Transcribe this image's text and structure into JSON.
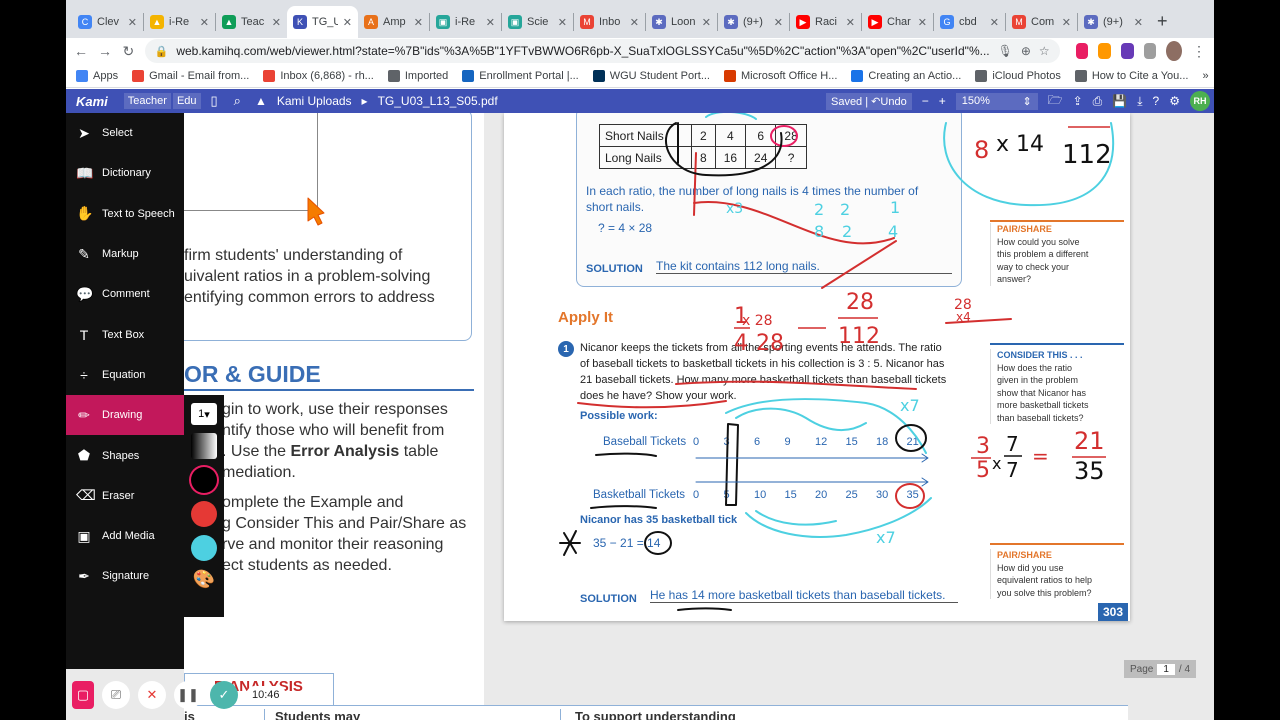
{
  "browser": {
    "tabs": [
      {
        "label": "Clev",
        "color": "#4285f4",
        "glyph": "C"
      },
      {
        "label": "i-Re",
        "color": "#f4b400",
        "glyph": "▲"
      },
      {
        "label": "Teac",
        "color": "#0f9d58",
        "glyph": "▲"
      },
      {
        "label": "TG_U",
        "color": "#3f51b5",
        "glyph": "K",
        "active": true
      },
      {
        "label": "Amp",
        "color": "#e8711a",
        "glyph": "A"
      },
      {
        "label": "i-Re",
        "color": "#26a69a",
        "glyph": "▣"
      },
      {
        "label": "Scie",
        "color": "#26a69a",
        "glyph": "▣"
      },
      {
        "label": "Inbo",
        "color": "#ea4335",
        "glyph": "M"
      },
      {
        "label": "Loon",
        "color": "#5c6bc0",
        "glyph": "✱"
      },
      {
        "label": "(9+)",
        "color": "#5c6bc0",
        "glyph": "✱"
      },
      {
        "label": "Raci",
        "color": "#ff0000",
        "glyph": "▶"
      },
      {
        "label": "Char",
        "color": "#ff0000",
        "glyph": "▶"
      },
      {
        "label": "cbd",
        "color": "#4285f4",
        "glyph": "G"
      },
      {
        "label": "Com",
        "color": "#ea4335",
        "glyph": "M"
      },
      {
        "label": "(9+)",
        "color": "#5c6bc0",
        "glyph": "✱"
      }
    ],
    "new_tab": "+",
    "url": "web.kamihq.com/web/viewer.html?state=%7B\"ids\"%3A%5B\"1YFTvBWWO6R6pb-X_SuaTxlOGLSSYCa5u\"%5D%2C\"action\"%3A\"open\"%2C\"userId\"%...",
    "bookmarks": [
      {
        "label": "Apps",
        "color": "#4285f4"
      },
      {
        "label": "Gmail - Email from...",
        "color": "#ea4335"
      },
      {
        "label": "Inbox (6,868) - rh...",
        "color": "#ea4335"
      },
      {
        "label": "Imported",
        "color": "#5f6368"
      },
      {
        "label": "Enrollment Portal |...",
        "color": "#1565c0"
      },
      {
        "label": "WGU Student Port...",
        "color": "#003057"
      },
      {
        "label": "Microsoft Office H...",
        "color": "#d83b01"
      },
      {
        "label": "Creating an Actio...",
        "color": "#1a73e8"
      },
      {
        "label": "iCloud Photos",
        "color": "#5f6368"
      },
      {
        "label": "How to Cite a You...",
        "color": "#5f6368"
      }
    ],
    "bookmarks_more": "»"
  },
  "kami": {
    "logo": "Kami",
    "role_teacher": "Teacher",
    "role_edu": "Edu",
    "breadcrumb_folder": "Kami Uploads",
    "breadcrumb_sep": "▸",
    "file_name": "TG_U03_L13_S05.pdf",
    "saved": "Saved",
    "undo": "Undo",
    "zoom_minus": "−",
    "zoom_plus": "+",
    "zoom": "150%",
    "avatar": "RH"
  },
  "tools": [
    {
      "label": "Select",
      "icon": "➤"
    },
    {
      "label": "Dictionary",
      "icon": "📖"
    },
    {
      "label": "Text to Speech",
      "icon": "✋"
    },
    {
      "label": "Markup",
      "icon": "✎"
    },
    {
      "label": "Comment",
      "icon": "💬"
    },
    {
      "label": "Text Box",
      "icon": "T"
    },
    {
      "label": "Equation",
      "icon": "÷"
    },
    {
      "label": "Drawing",
      "icon": "✏",
      "active": true
    },
    {
      "label": "Shapes",
      "icon": "⬟"
    },
    {
      "label": "Eraser",
      "icon": "⌫"
    },
    {
      "label": "Add Media",
      "icon": "▣"
    },
    {
      "label": "Signature",
      "icon": "✒"
    }
  ],
  "drawing_panel": {
    "line_width": "1",
    "colors": [
      "#000000",
      "#e53935",
      "#4dd0e1"
    ]
  },
  "recording": {
    "time": "10:46"
  },
  "left_page": {
    "lines_top": [
      "firm students' understanding of",
      "uivalent ratios in a problem-solving",
      "entifying common errors to address"
    ],
    "heading": "OR & GUIDE",
    "lines_mid": [
      "gin to work, use their responses",
      "ntify those who will benefit from",
      ". Use the ",
      "mediation.",
      "omplete the Example and",
      "g Consider This and Pair/Share as",
      "rve and monitor their reasoning",
      "ect students as needed."
    ],
    "error_analysis_bold": "Error Analysis",
    "error_analysis_after": " table",
    "bottom_heading": "R ANALYSIS"
  },
  "right_page": {
    "table": {
      "rows": [
        {
          "label": "Short Nails",
          "values": [
            "2",
            "4",
            "6",
            "28"
          ]
        },
        {
          "label": "Long Nails",
          "values": [
            "8",
            "16",
            "24",
            "?"
          ]
        }
      ]
    },
    "ratio_text_1": "In each ratio, the number of long nails is 4 times the number of",
    "ratio_text_2": "short nails.",
    "equation_1": "? = 4 × 28",
    "solution_label": "SOLUTION",
    "solution_1": "The kit contains 112 long nails.",
    "pair_share_1": {
      "title": "PAIR/SHARE",
      "lines": [
        "How could you solve",
        "this problem a different",
        "way to check your",
        "answer?"
      ]
    },
    "apply_it": "Apply It",
    "problem_number": "1",
    "problem_lines": [
      "Nicanor keeps the tickets from all the sporting events he attends. The ratio",
      "of baseball tickets to basketball tickets in his collection is 3 : 5. Nicanor has",
      "21 baseball tickets. How many more basketball tickets than baseball tickets",
      "does he have? Show your work."
    ],
    "consider_this": {
      "title": "CONSIDER THIS . . .",
      "lines": [
        "How does the ratio",
        "given in the problem",
        "show that Nicanor has",
        "more basketball tickets",
        "than baseball tickets?"
      ]
    },
    "possible_work": "Possible work:",
    "baseball_label": "Baseball Tickets",
    "baseball_ticks": [
      "0",
      "3",
      "6",
      "9",
      "12",
      "15",
      "18",
      "21"
    ],
    "basketball_label": "Basketball Tickets",
    "basketball_ticks": [
      "0",
      "5",
      "10",
      "15",
      "20",
      "25",
      "30",
      "35"
    ],
    "nicanor_has": "Nicanor has 35 basketball tick",
    "equation_2": "35 − 21 = 14",
    "solution_2": "He has 14 more basketball tickets than baseball tickets.",
    "pair_share_2": {
      "title": "PAIR/SHARE",
      "lines": [
        "How did you use",
        "equivalent ratios to help",
        "you solve this problem?"
      ]
    },
    "page_number": "303"
  },
  "handwriting": {
    "frac_1_4_num": "1",
    "frac_1_4_den": "4",
    "times_28": "x 28",
    "den_28": "28",
    "frac_28_num": "28",
    "frac_112_den": "112",
    "calc_28": "28",
    "calc_x4": "x4",
    "frac_2_8": "2",
    "frac_8": "8",
    "div_2a": "2",
    "div_2b": "2",
    "frac_1": "1",
    "frac_4": "4",
    "x3": "x3",
    "top_8": "8",
    "top_x14": "x 14",
    "top_112": "112",
    "x7_a": "x7",
    "x7_b": "x7",
    "r_3": "3",
    "r_5": "5",
    "r_7a": "7",
    "r_7b": "7",
    "r_x": "x",
    "r_eq": "=",
    "r_21": "21",
    "r_35": "35"
  },
  "page_indicator": {
    "label": "Page",
    "current": "1",
    "total": "/ 4"
  },
  "bottom_table": {
    "col1": "is",
    "col2": "Students may",
    "col3": "To support understanding"
  }
}
